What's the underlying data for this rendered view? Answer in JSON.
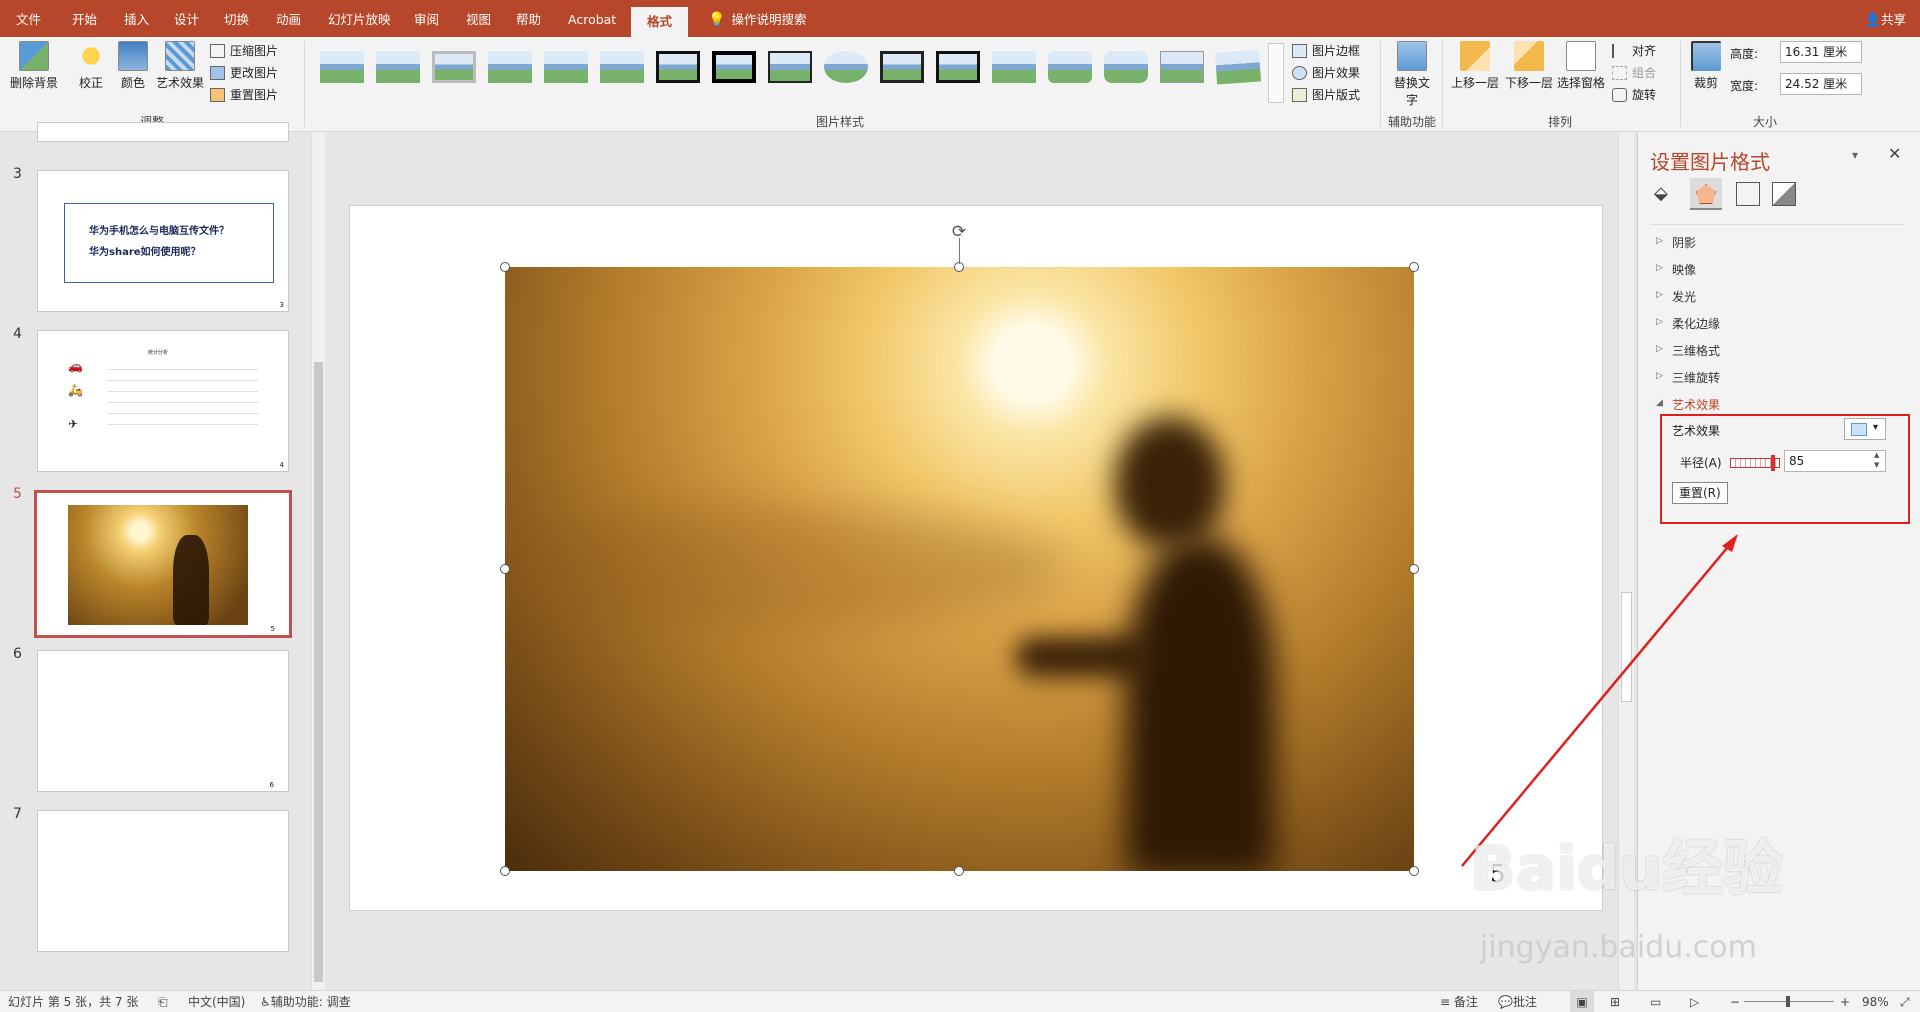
{
  "tabs": [
    "文件",
    "开始",
    "插入",
    "设计",
    "切换",
    "动画",
    "幻灯片放映",
    "审阅",
    "视图",
    "帮助",
    "Acrobat",
    "格式"
  ],
  "active_tab": "格式",
  "tell_me": "操作说明搜索",
  "share": "共享",
  "ribbon": {
    "adjust": {
      "remove_bg": "删除背景",
      "corrections": "校正",
      "color": "颜色",
      "artistic": "艺术效果",
      "compress": "压缩图片",
      "change": "更改图片",
      "reset": "重置图片",
      "label": "调整"
    },
    "styles": {
      "border": "图片边框",
      "effects": "图片效果",
      "layout": "图片版式",
      "label": "图片样式"
    },
    "accessibility": {
      "alt_text": "替换文字",
      "label": "辅助功能"
    },
    "arrange": {
      "forward": "上移一层",
      "backward": "下移一层",
      "selection_pane": "选择窗格",
      "align": "对齐",
      "group": "组合",
      "rotate": "旋转",
      "label": "排列"
    },
    "size": {
      "crop": "裁剪",
      "height_label": "高度:",
      "height_value": "16.31 厘米",
      "width_label": "宽度:",
      "width_value": "24.52 厘米",
      "label": "大小"
    }
  },
  "thumbnails": [
    {
      "num": "3",
      "title_line1": "华为手机怎么与电脑互传文件？",
      "title_line2": "华为share如何使用呢？",
      "page": "3"
    },
    {
      "num": "4",
      "chart_title": "统计分析",
      "page": "4"
    },
    {
      "num": "5",
      "page": "5"
    },
    {
      "num": "6",
      "page": "6"
    },
    {
      "num": "7",
      "page": ""
    }
  ],
  "slide": {
    "page_number": "5"
  },
  "panel": {
    "title": "设置图片格式",
    "sections": [
      "阴影",
      "映像",
      "发光",
      "柔化边缘",
      "三维格式",
      "三维旋转"
    ],
    "expanded_section": "艺术效果",
    "art_effect_label": "艺术效果",
    "radius_label": "半径(A)",
    "radius_value": "85",
    "reset_button": "重置(R)"
  },
  "statusbar": {
    "slide_info": "幻灯片 第 5 张，共 7 张",
    "language": "中文(中国)",
    "accessibility": "辅助功能: 调查",
    "notes": "备注",
    "comments": "批注",
    "zoom": "98%"
  },
  "watermark": {
    "brand": "Baidu经验",
    "url": "jingyan.baidu.com"
  },
  "colors": {
    "accent": "#b7472a",
    "highlight_box": "#e0201c",
    "arrow": "#e0201c"
  }
}
